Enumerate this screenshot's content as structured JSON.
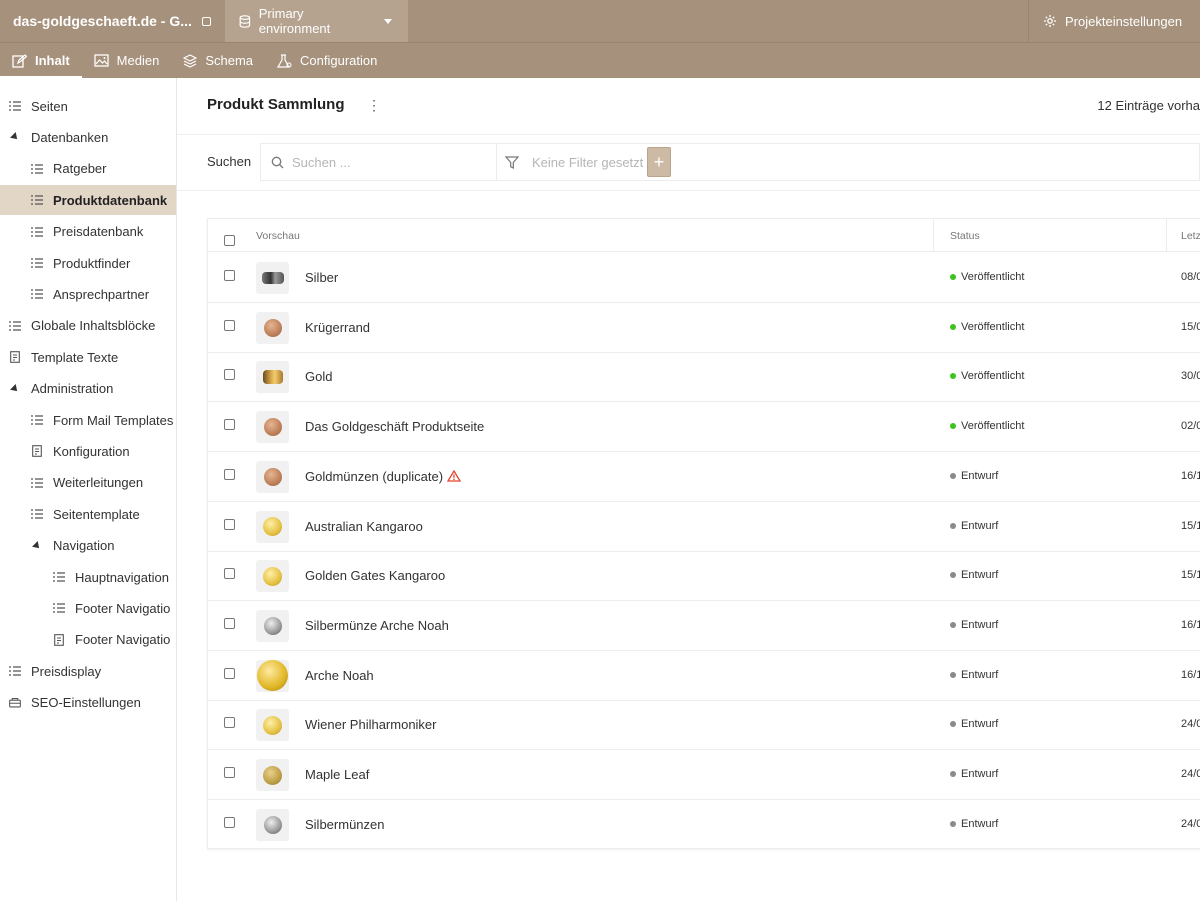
{
  "topbar": {
    "project": "das-goldgeschaeft.de - G...",
    "environment": "Primary environment",
    "settings": "Projekteinstellungen"
  },
  "navtabs": [
    "Inhalt",
    "Medien",
    "Schema",
    "Configuration"
  ],
  "sidebar": {
    "items": [
      {
        "label": "Seiten",
        "icon": "list-icon"
      },
      {
        "label": "Datenbanken",
        "icon": "triangle-icon"
      },
      {
        "label": "Ratgeber",
        "icon": "list-icon"
      },
      {
        "label": "Produktdatenbank",
        "icon": "list-icon"
      },
      {
        "label": "Preisdatenbank",
        "icon": "list-icon"
      },
      {
        "label": "Produktfinder",
        "icon": "list-icon"
      },
      {
        "label": "Ansprechpartner",
        "icon": "list-icon"
      },
      {
        "label": "Globale Inhaltsblöcke",
        "icon": "list-icon"
      },
      {
        "label": "Template Texte",
        "icon": "document-icon"
      },
      {
        "label": "Administration",
        "icon": "triangle-icon"
      },
      {
        "label": "Form Mail Templates",
        "icon": "list-icon"
      },
      {
        "label": "Konfiguration",
        "icon": "document-icon"
      },
      {
        "label": "Weiterleitungen",
        "icon": "list-icon"
      },
      {
        "label": "Seitentemplate",
        "icon": "list-icon"
      },
      {
        "label": "Navigation",
        "icon": "triangle-icon"
      },
      {
        "label": "Hauptnavigation",
        "icon": "list-icon"
      },
      {
        "label": "Footer Navigatio",
        "icon": "list-icon"
      },
      {
        "label": "Footer Navigatio",
        "icon": "document-icon"
      },
      {
        "label": "Preisdisplay",
        "icon": "list-icon"
      },
      {
        "label": "SEO-Einstellungen",
        "icon": "seo-icon"
      }
    ]
  },
  "main": {
    "title": "Produkt Sammlung",
    "count": "12 Einträge vorha",
    "search_label": "Suchen",
    "search_placeholder": "Suchen ...",
    "filter_text": "Keine Filter gesetzt",
    "add_label": "+"
  },
  "table": {
    "headers": [
      "Vorschau",
      "Status",
      "Letz"
    ],
    "rows": [
      {
        "name": "Silber",
        "status": "Veröffentlicht",
        "date": "08/0",
        "coin": "silver-bars",
        "warning": false
      },
      {
        "name": "Krügerrand",
        "status": "Veröffentlicht",
        "date": "15/0",
        "coin": "copper",
        "warning": false
      },
      {
        "name": "Gold",
        "status": "Veröffentlicht",
        "date": "30/0",
        "coin": "gold-stack",
        "warning": false
      },
      {
        "name": "Das Goldgeschäft Produktseite",
        "status": "Veröffentlicht",
        "date": "02/0",
        "coin": "copper",
        "warning": false
      },
      {
        "name": "Goldmünzen (duplicate)",
        "status": "Entwurf",
        "date": "16/1",
        "coin": "copper",
        "warning": true
      },
      {
        "name": "Australian Kangaroo",
        "status": "Entwurf",
        "date": "15/1",
        "coin": "gold",
        "warning": false
      },
      {
        "name": "Golden Gates Kangaroo",
        "status": "Entwurf",
        "date": "15/1",
        "coin": "gold",
        "warning": false
      },
      {
        "name": "Silbermünze Arche Noah",
        "status": "Entwurf",
        "date": "16/1",
        "coin": "silver",
        "warning": false
      },
      {
        "name": "Arche Noah",
        "status": "Entwurf",
        "date": "16/1",
        "coin": "gold-large",
        "warning": false
      },
      {
        "name": "Wiener Philharmoniker",
        "status": "Entwurf",
        "date": "24/0",
        "coin": "gold",
        "warning": false
      },
      {
        "name": "Maple Leaf",
        "status": "Entwurf",
        "date": "24/0",
        "coin": "gold-dark",
        "warning": false
      },
      {
        "name": "Silbermünzen",
        "status": "Entwurf",
        "date": "24/0",
        "coin": "silver",
        "warning": false
      }
    ]
  },
  "colors": {
    "brand": "#a6917c",
    "active_bg": "#e2d6c7",
    "published": "#3cc31c",
    "draft": "#8a8a8a",
    "warning": "#e2452f"
  }
}
